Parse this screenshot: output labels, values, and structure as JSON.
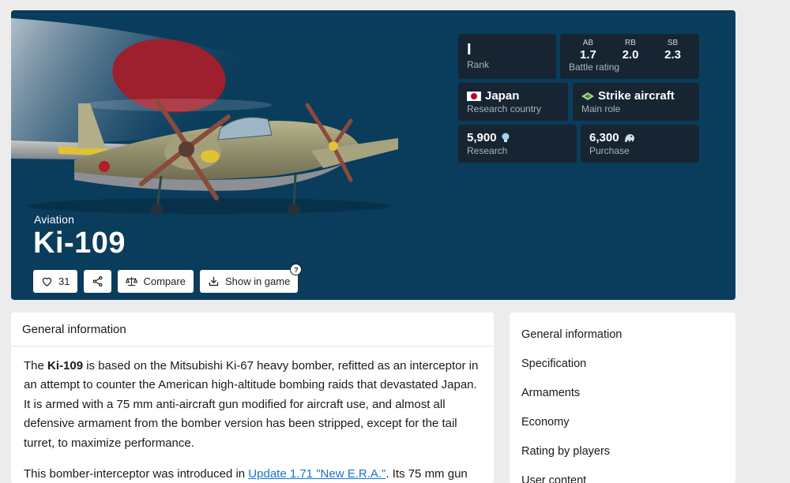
{
  "hero": {
    "category": "Aviation",
    "title": "Ki-109",
    "actions": {
      "likes": "31",
      "compare_label": "Compare",
      "show_in_game_label": "Show in game",
      "help_mark": "?"
    },
    "stats": {
      "rank_value": "I",
      "rank_label": "Rank",
      "battle_rating": {
        "label": "Battle rating",
        "modes": [
          {
            "mode": "AB",
            "value": "1.7"
          },
          {
            "mode": "RB",
            "value": "2.0"
          },
          {
            "mode": "SB",
            "value": "2.3"
          }
        ]
      },
      "country_value": "Japan",
      "country_label": "Research country",
      "role_value": "Strike aircraft",
      "role_label": "Main role",
      "research_value": "5,900",
      "research_label": "Research",
      "purchase_value": "6,300",
      "purchase_label": "Purchase"
    }
  },
  "main": {
    "heading": "General information",
    "p1_pre": "The ",
    "p1_bold": "Ki-109",
    "p1_post": " is based on the Mitsubishi Ki-67 heavy bomber, refitted as an interceptor in an attempt to counter the American high-altitude bombing raids that devastated Japan. It is armed with a 75 mm anti-aircraft gun modified for aircraft use, and almost all defensive armament from the bomber version has been stripped, except for the tail turret, to maximize performance.",
    "p2_pre": "This bomber-interceptor was introduced in ",
    "p2_link": "Update 1.71 \"New E.R.A.\"",
    "p2_post": ". Its 75 mm gun"
  },
  "sidebar": {
    "items": [
      {
        "label": "General information"
      },
      {
        "label": "Specification"
      },
      {
        "label": "Armaments"
      },
      {
        "label": "Economy"
      },
      {
        "label": "Rating by players"
      },
      {
        "label": "User content"
      }
    ]
  },
  "colors": {
    "hero_bg": "#0a3c5c",
    "stat_bg": "#172532",
    "link": "#1a73c8",
    "flag_red": "#bc002d"
  }
}
